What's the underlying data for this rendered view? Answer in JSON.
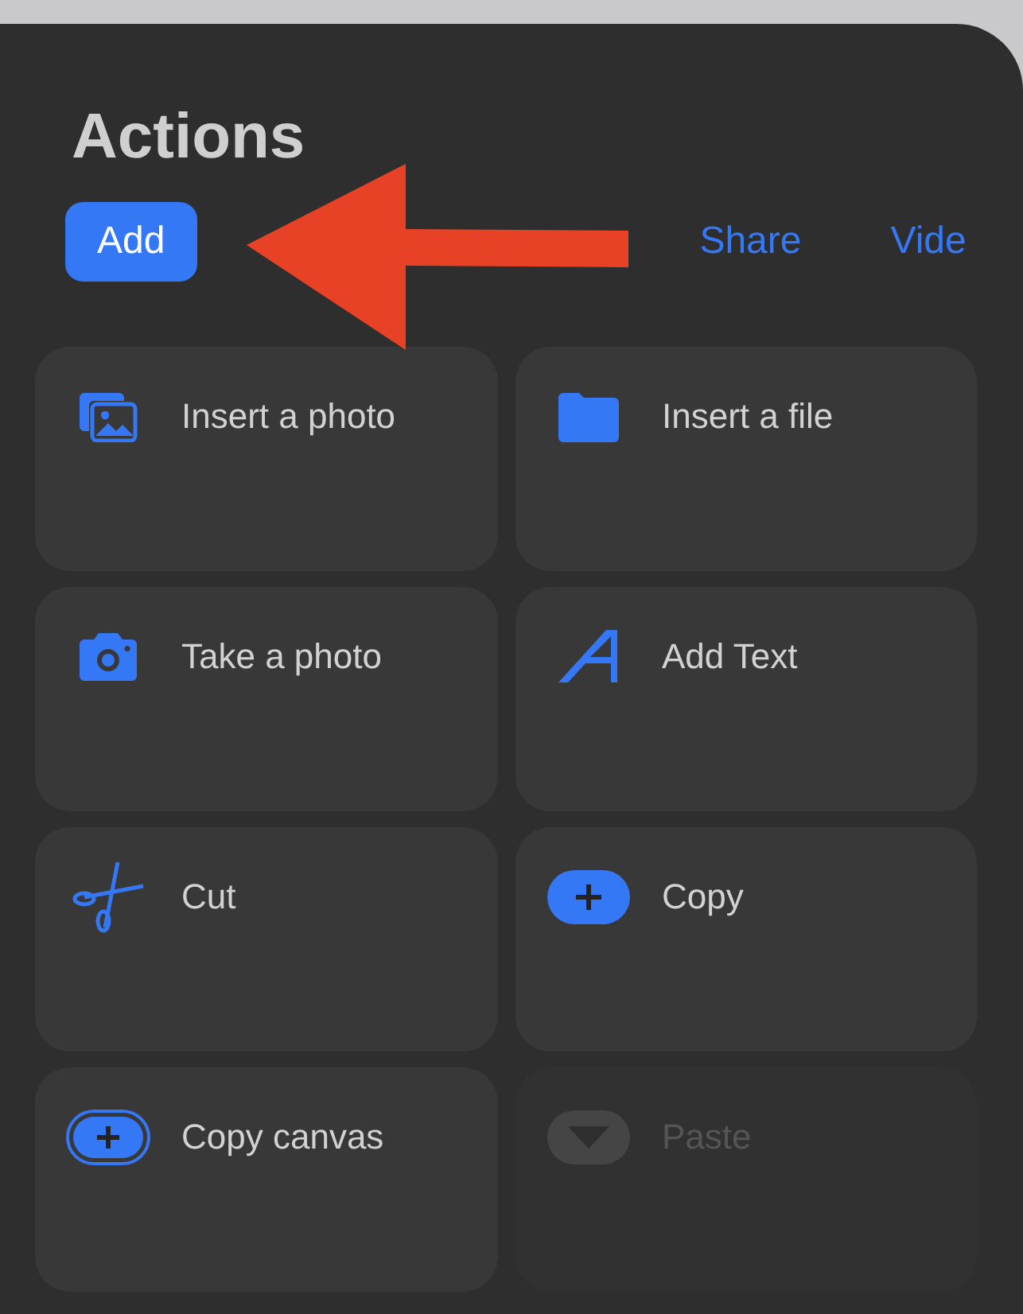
{
  "panel": {
    "title": "Actions"
  },
  "tabs": [
    {
      "label": "Add",
      "selected": true
    },
    {
      "label": "Share",
      "selected": false
    },
    {
      "label": "Vide",
      "selected": false
    }
  ],
  "actions": [
    {
      "kind": "photo",
      "label": "Insert a photo",
      "disabled": false
    },
    {
      "kind": "file",
      "label": "Insert a file",
      "disabled": false
    },
    {
      "kind": "camera",
      "label": "Take a photo",
      "disabled": false
    },
    {
      "kind": "text",
      "label": "Add Text",
      "disabled": false
    },
    {
      "kind": "scissors",
      "label": "Cut",
      "disabled": false
    },
    {
      "kind": "copy",
      "label": "Copy",
      "disabled": false
    },
    {
      "kind": "copy-canvas",
      "label": "Copy canvas",
      "disabled": false
    },
    {
      "kind": "paste",
      "label": "Paste",
      "disabled": true
    }
  ]
}
